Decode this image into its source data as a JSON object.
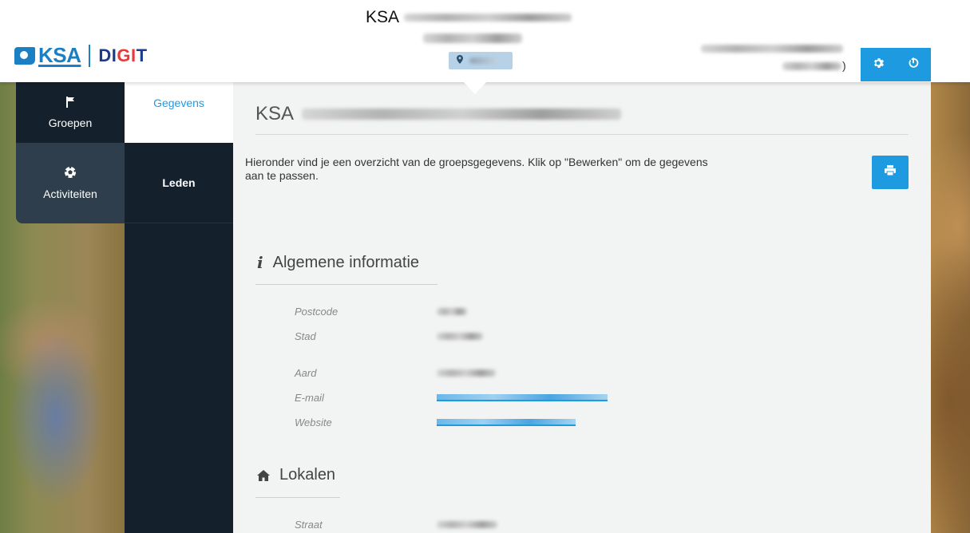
{
  "header": {
    "group_title_prefix": "KSA",
    "logo_ksa": "KSA",
    "logo_digit_di": "DI",
    "logo_digit_gi": "GI",
    "logo_digit_t": "T",
    "user_paren": ")",
    "settings_icon": "gear-icon",
    "power_icon": "power-icon",
    "location_icon": "map-marker-icon"
  },
  "nav": {
    "items": [
      {
        "label": "Groepen",
        "icon": "flag-icon"
      },
      {
        "label": "Activiteiten",
        "icon": "soccer-ball-icon"
      }
    ]
  },
  "subnav": {
    "items": [
      {
        "label": "Gegevens"
      },
      {
        "label": "Leden"
      }
    ]
  },
  "content": {
    "title_prefix": "KSA",
    "intro": "Hieronder vind je een overzicht van de groepsgegevens. Klik op \"Bewerken\" om de gegevens aan te passen.",
    "print_icon": "print-icon",
    "sections": [
      {
        "heading": "Algemene informatie",
        "icon": "info-icon",
        "fields": [
          "Postcode",
          "Stad",
          "Aard",
          "E-mail",
          "Website"
        ]
      },
      {
        "heading": "Lokalen",
        "icon": "home-icon",
        "fields": [
          "Straat"
        ]
      }
    ]
  },
  "colors": {
    "accent": "#1e9be0",
    "nav_dark": "#14202c",
    "nav_inactive": "#2e3e4c",
    "content_bg": "#f2f3f3"
  }
}
